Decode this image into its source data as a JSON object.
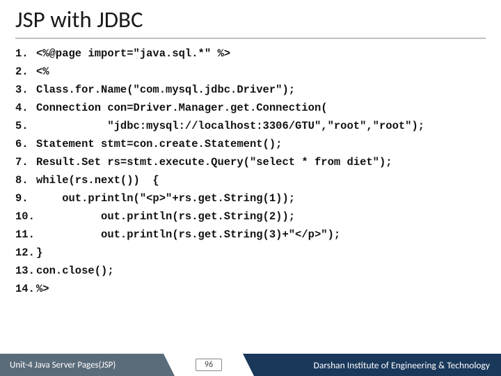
{
  "title": "JSP with JDBC",
  "code_lines": [
    {
      "n": "1.",
      "t": "<%@page import=\"java.sql.*\" %>"
    },
    {
      "n": "2.",
      "t": "<%"
    },
    {
      "n": "3.",
      "t": "Class.for.Name(\"com.mysql.jdbc.Driver\");"
    },
    {
      "n": "4.",
      "t": "Connection con=Driver.Manager.get.Connection("
    },
    {
      "n": "5.",
      "t": "           \"jdbc:mysql://localhost:3306/GTU\",\"root\",\"root\");"
    },
    {
      "n": "6.",
      "t": "Statement stmt=con.create.Statement();"
    },
    {
      "n": "7.",
      "t": "Result.Set rs=stmt.execute.Query(\"select * from diet\");"
    },
    {
      "n": "8.",
      "t": "while(rs.next())  {"
    },
    {
      "n": "9.",
      "t": "    out.println(\"<p>\"+rs.get.String(1));"
    },
    {
      "n": "10.",
      "t": "          out.println(rs.get.String(2));"
    },
    {
      "n": "11.",
      "t": "          out.println(rs.get.String(3)+\"</p>\");"
    },
    {
      "n": "12.",
      "t": "}"
    },
    {
      "n": "13.",
      "t": "con.close();"
    },
    {
      "n": "14.",
      "t": "%>"
    }
  ],
  "footer": {
    "left": "Unit-4 Java Server Pages(JSP)",
    "page": "96",
    "right": "Darshan Institute of Engineering & Technology"
  }
}
